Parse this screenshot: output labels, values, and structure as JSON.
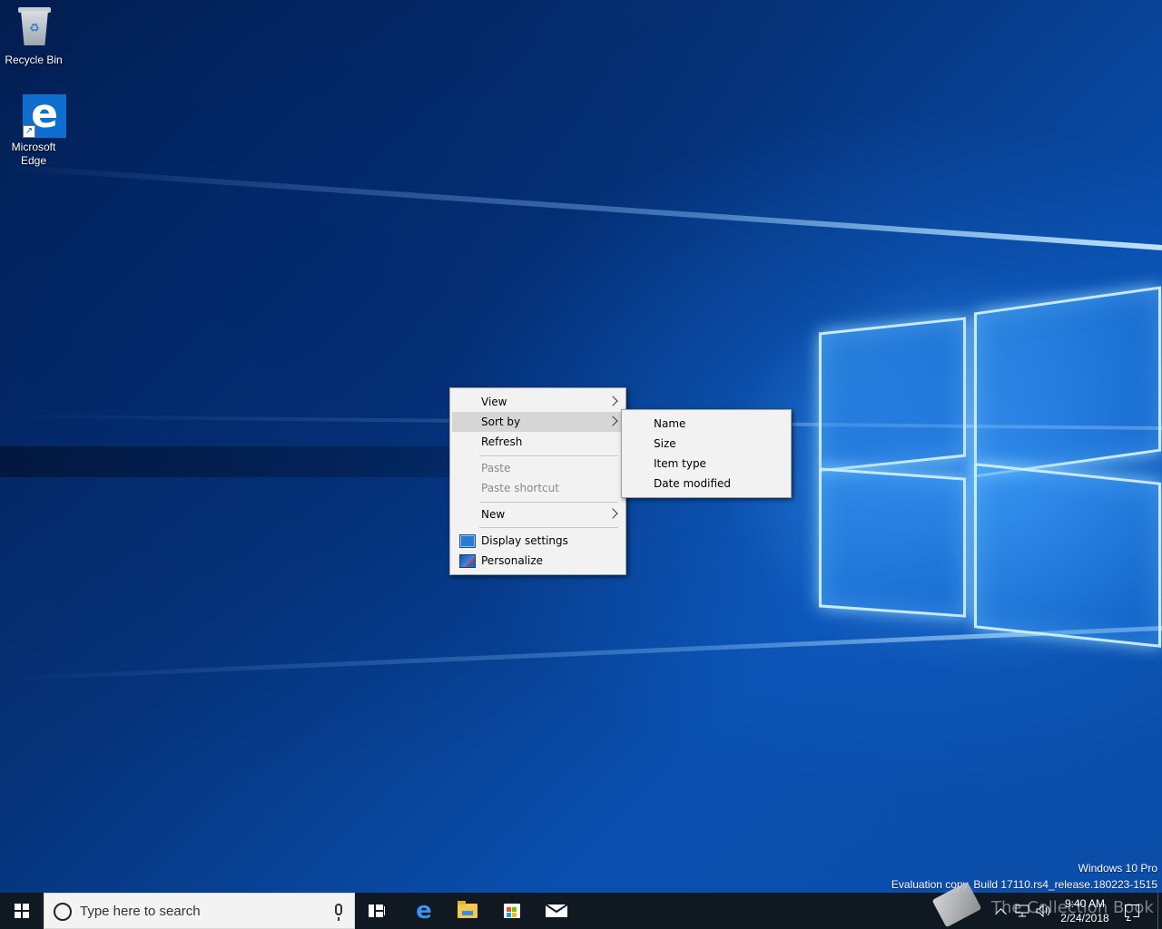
{
  "desktop": {
    "icons": [
      {
        "label": "Recycle Bin",
        "icon": "recycle-bin-icon"
      },
      {
        "label": "Microsoft Edge",
        "icon": "edge-icon"
      }
    ],
    "watermark": {
      "edition": "Windows 10 Pro",
      "build": "Evaluation copy. Build 17110.rs4_release.180223-1515"
    }
  },
  "context_menu": {
    "items": [
      {
        "label": "View",
        "has_submenu": true,
        "enabled": true
      },
      {
        "label": "Sort by",
        "has_submenu": true,
        "enabled": true,
        "highlighted": true
      },
      {
        "label": "Refresh",
        "enabled": true
      },
      {
        "label": "Paste",
        "enabled": false
      },
      {
        "label": "Paste shortcut",
        "enabled": false
      },
      {
        "label": "New",
        "has_submenu": true,
        "enabled": true
      },
      {
        "label": "Display settings",
        "icon": "display-settings-icon",
        "enabled": true
      },
      {
        "label": "Personalize",
        "icon": "personalize-icon",
        "enabled": true
      }
    ]
  },
  "sort_submenu": {
    "items": [
      {
        "label": "Name"
      },
      {
        "label": "Size"
      },
      {
        "label": "Item type"
      },
      {
        "label": "Date modified"
      }
    ]
  },
  "taskbar": {
    "search_placeholder": "Type here to search",
    "pinned": [
      "task-view-icon",
      "edge-icon",
      "file-explorer-icon",
      "store-icon",
      "mail-icon"
    ],
    "clock": {
      "time": "9:40 AM",
      "date": "2/24/2018"
    },
    "overlay_text": "The Collection Book"
  },
  "colors": {
    "taskbar": "#101822",
    "menu_bg": "#f2f2f2",
    "menu_highlight": "#d6d6d6",
    "accent": "#0f6fd0"
  }
}
